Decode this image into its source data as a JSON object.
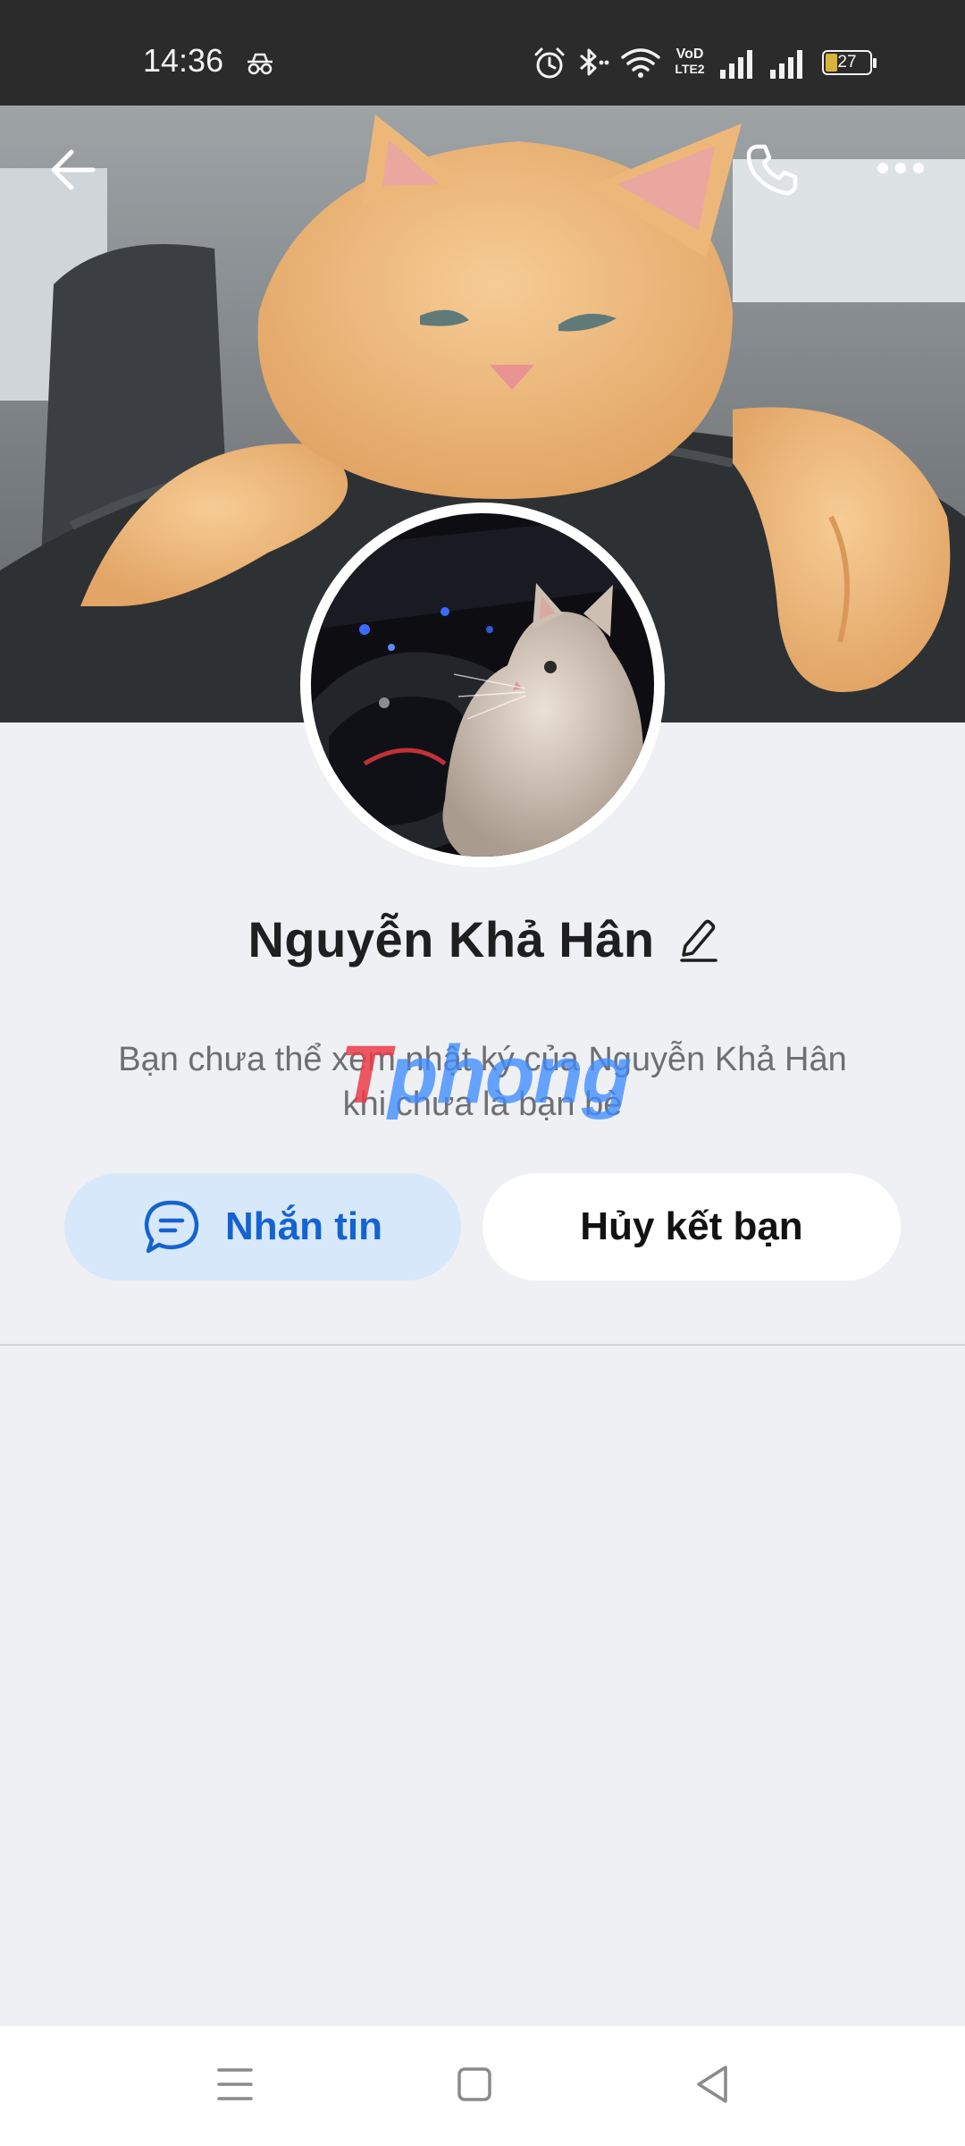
{
  "status_bar": {
    "time": "14:36",
    "battery": "27",
    "volte_top": "VoD",
    "volte_bottom": "LTE2",
    "icons": [
      "incognito-icon",
      "alarm-icon",
      "bluetooth-icon",
      "wifi-icon",
      "volte-icon",
      "signal-icon",
      "signal-icon",
      "battery-icon"
    ]
  },
  "header": {
    "back_icon": "back-arrow-icon",
    "call_icon": "phone-icon",
    "more_icon": "more-options-icon"
  },
  "profile": {
    "name": "Nguyễn Khả Hân",
    "edit_icon": "pencil-icon",
    "privacy_note_line1": "Bạn chưa thể xem nhật ký của Nguyễn Khả Hân",
    "privacy_note_line2": "khi chưa là bạn bè"
  },
  "actions": {
    "message_label": "Nhắn tin",
    "message_icon": "chat-bubble-icon",
    "unfriend_label": "Hủy kết bạn"
  },
  "watermark": {
    "first_letter": "T",
    "rest": "phong"
  },
  "nav_bar": {
    "icons": [
      "menu-icon",
      "home-icon",
      "back-icon"
    ]
  },
  "colors": {
    "accent": "#1463d1",
    "message_button_bg": "#d8e8fb",
    "page_bg": "#eff0f4"
  }
}
